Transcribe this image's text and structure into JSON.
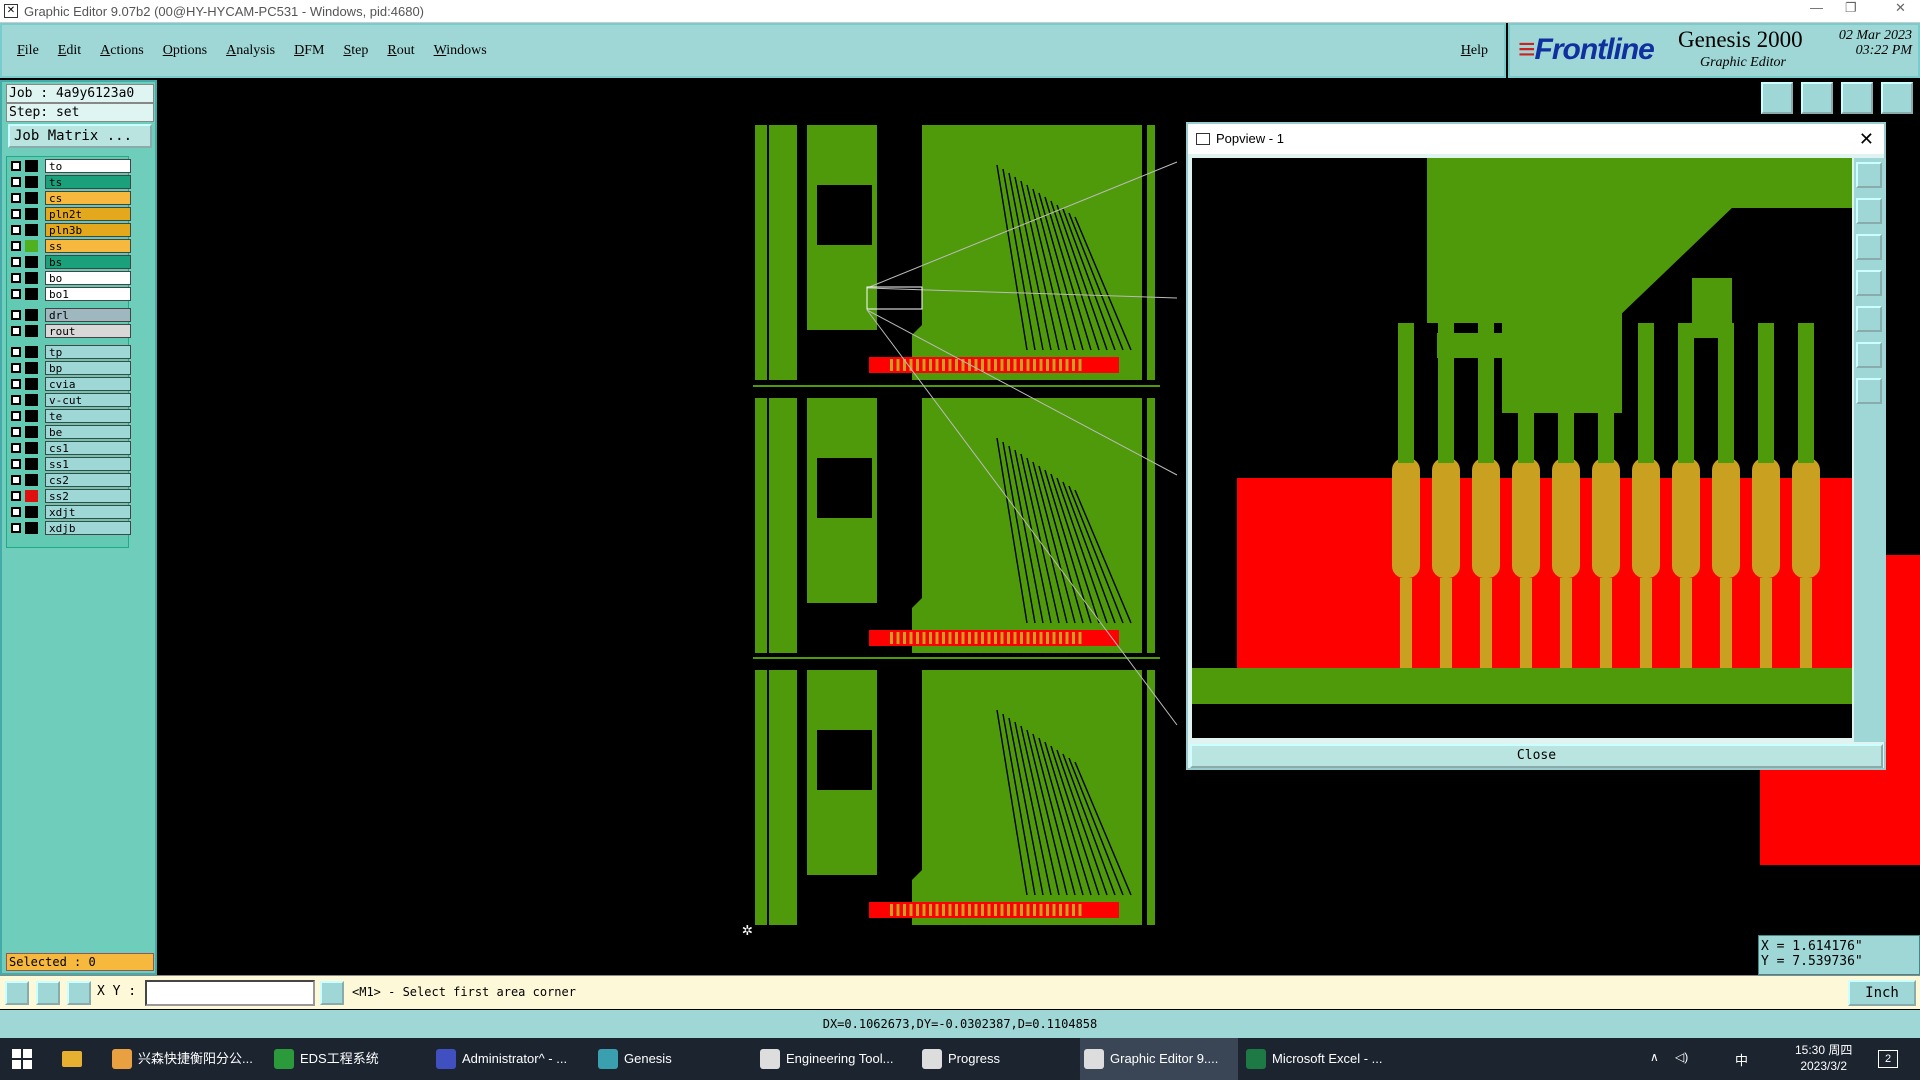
{
  "window": {
    "title": "Graphic Editor 9.07b2 (00@HY-HYCAM-PC531 - Windows, pid:4680)"
  },
  "menu": {
    "items": [
      "File",
      "Edit",
      "Actions",
      "Options",
      "Analysis",
      "DFM",
      "Step",
      "Rout",
      "Windows"
    ],
    "help": "Help"
  },
  "brand": {
    "logo": "Frontline",
    "product": "Genesis 2000",
    "subtitle": "Graphic Editor",
    "date": "02 Mar 2023",
    "time": "03:22 PM"
  },
  "job": {
    "job_label": "Job : 4a9y6123a0",
    "step_label": "Step: set",
    "matrix_button": "Job Matrix ..."
  },
  "layers": [
    {
      "name": "to",
      "color": "#ffffff",
      "swatch": "#000000"
    },
    {
      "name": "ts",
      "color": "#1aa07a",
      "swatch": "#000000"
    },
    {
      "name": "cs",
      "color": "#f6b93d",
      "swatch": "#000000"
    },
    {
      "name": "pln2t",
      "color": "#e3a81b",
      "swatch": "#000000"
    },
    {
      "name": "pln3b",
      "color": "#e3a81b",
      "swatch": "#000000"
    },
    {
      "name": "ss",
      "color": "#f6b93d",
      "swatch": "#4fb020"
    },
    {
      "name": "bs",
      "color": "#1aa07a",
      "swatch": "#000000"
    },
    {
      "name": "bo",
      "color": "#ffffff",
      "swatch": "#000000"
    },
    {
      "name": "bo1",
      "color": "#ffffff",
      "swatch": "#000000"
    },
    {
      "name": "drl",
      "color": "#9fb8c0",
      "swatch": "#000000"
    },
    {
      "name": "rout",
      "color": "#d8d8d8",
      "swatch": "#000000"
    },
    {
      "name": "tp",
      "color": "#9ed7d6",
      "swatch": "#000000"
    },
    {
      "name": "bp",
      "color": "#9ed7d6",
      "swatch": "#000000"
    },
    {
      "name": "cvia",
      "color": "#9ed7d6",
      "swatch": "#000000"
    },
    {
      "name": "v-cut",
      "color": "#9ed7d6",
      "swatch": "#000000"
    },
    {
      "name": "te",
      "color": "#9ed7d6",
      "swatch": "#000000"
    },
    {
      "name": "be",
      "color": "#9ed7d6",
      "swatch": "#000000"
    },
    {
      "name": "cs1",
      "color": "#9ed7d6",
      "swatch": "#000000"
    },
    {
      "name": "ss1",
      "color": "#9ed7d6",
      "swatch": "#000000"
    },
    {
      "name": "cs2",
      "color": "#9ed7d6",
      "swatch": "#000000"
    },
    {
      "name": "ss2",
      "color": "#9ed7d6",
      "swatch": "#e01010"
    },
    {
      "name": "xdjt",
      "color": "#9ed7d6",
      "swatch": "#000000"
    },
    {
      "name": "xdjb",
      "color": "#9ed7d6",
      "swatch": "#000000"
    }
  ],
  "selected_label": "Selected : 0",
  "popview": {
    "title": "Popview - 1",
    "close_label": "Close"
  },
  "coords": {
    "x": "X = 1.614176\"",
    "y": "Y = 7.539736\""
  },
  "command": {
    "xy_label": "X Y :",
    "prompt": "<M1> - Select first area corner",
    "unit": "Inch"
  },
  "status": "DX=0.1062673,DY=-0.0302387,D=0.1104858",
  "taskbar": {
    "items": [
      {
        "label": "兴森快捷衡阳分公...",
        "color": "#e8a040"
      },
      {
        "label": "EDS工程系统",
        "color": "#2a9a3a"
      },
      {
        "label": "Administrator^ - ...",
        "color": "#4050c0"
      },
      {
        "label": "Genesis",
        "color": "#3aa0b0"
      },
      {
        "label": "Engineering Tool...",
        "color": "#dddddd"
      },
      {
        "label": "Progress",
        "color": "#dddddd"
      },
      {
        "label": "Graphic Editor 9....",
        "color": "#dddddd"
      },
      {
        "label": "Microsoft Excel - ...",
        "color": "#1e7a45"
      }
    ],
    "ime": "中",
    "clock_time": "15:30 周四",
    "clock_date": "2023/3/2",
    "notif_count": "2"
  },
  "colors": {
    "board": "#4f9a0a",
    "pad": "#ff0000",
    "gold": "#c9a020",
    "ui": "#9ed7d6"
  }
}
